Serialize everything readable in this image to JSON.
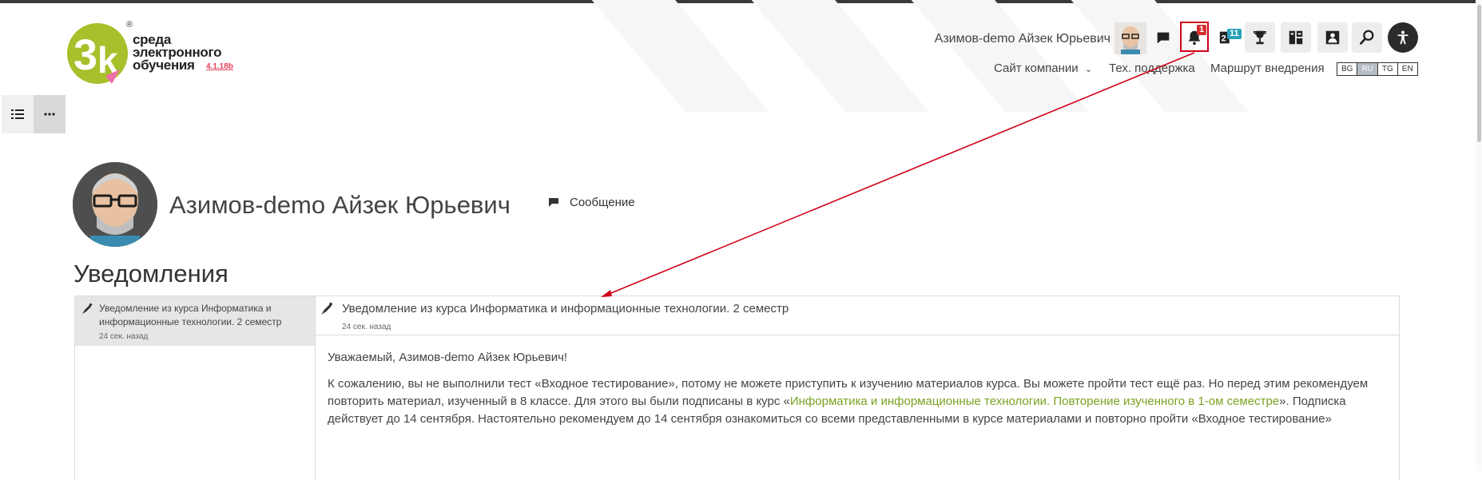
{
  "brand": {
    "logo_text_lines": [
      "среда",
      "электронного",
      "обучения"
    ],
    "version": "4.1.18b",
    "registered_mark": "®"
  },
  "header": {
    "user_name": "Азимов-demo Айзек Юрьевич",
    "notification_count": "1",
    "badge_count": "11",
    "nav": {
      "company_site": "Сайт компании",
      "support": "Тех. поддержка",
      "route": "Маршрут внедрения"
    },
    "languages": [
      "BG",
      "RU",
      "TG",
      "EN"
    ],
    "active_language": "RU",
    "colors": {
      "notification_badge": "#d32f2f",
      "counter_badge": "#2aa3b8",
      "highlight_box": "#d0021b"
    }
  },
  "icons": {
    "chat": "chat-icon",
    "bell": "bell-icon",
    "badges": "badge-icon",
    "trophy": "trophy-icon",
    "dashboard": "dashboard-icon",
    "contacts": "contacts-icon",
    "search": "search-icon",
    "accessibility": "accessibility-icon"
  },
  "profile": {
    "name": "Азимов-demo Айзек Юрьевич",
    "message_label": "Сообщение"
  },
  "page": {
    "heading": "Уведомления"
  },
  "notifications": {
    "items": [
      {
        "title": "Уведомление из курса Информатика и информационные технологии. 2 семестр",
        "time": "24 сек. назад"
      }
    ],
    "selected": {
      "title": "Уведомление из курса Информатика и информационные технологии. 2 семестр",
      "time": "24 сек. назад",
      "greeting": "Уважаемый, Азимов-demo Айзек Юрьевич!",
      "body_part1": "К сожалению, вы не выполнили тест «Входное тестирование», потому не можете приступить к изучению материалов курса. Вы можете пройти тест ещё раз. Но перед этим рекомендуем повторить материал, изученный в 8 классе. Для этого вы были подписаны в курс «",
      "course_link": "Информатика и информационные технологии. Повторение изученного в 1-ом семестре",
      "body_part2": "». Подписка действует до 14 сентября. Настоятельно рекомендуем до 14 сентября ознакомиться со всеми представленными в курсе материалами и повторно пройти «Входное тестирование»"
    },
    "link_color": "#7aa221"
  }
}
